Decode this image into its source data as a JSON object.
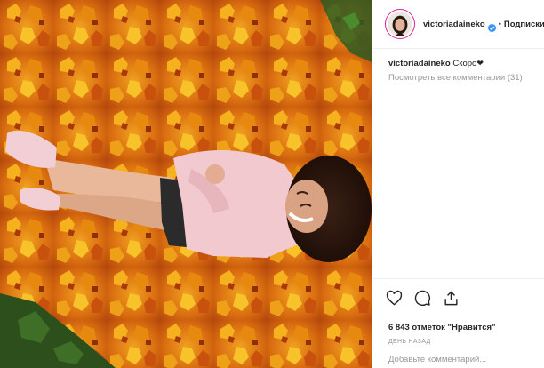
{
  "post": {
    "username": "victoriadaineko",
    "follow_label": "Подписки",
    "separator": "•",
    "caption_text": "Скоро",
    "caption_emoji": "❤",
    "view_all_comments": "Посмотреть все комментарии (31)",
    "likes_text": "6 843 отметок \"Нравится\"",
    "timestamp": "ДЕНЬ НАЗАД",
    "comment_placeholder": "Добавьте комментарий..."
  },
  "icons": {
    "verified": "verified-badge-icon",
    "like": "heart-icon",
    "comment": "comment-bubble-icon",
    "share": "share-icon"
  },
  "colors": {
    "verified_blue": "#3897f0",
    "avatar_ring": "#d6249f",
    "muted_text": "#999999",
    "leaf_orange": "#e0820f",
    "sweater_pink": "#f2c9cf"
  }
}
